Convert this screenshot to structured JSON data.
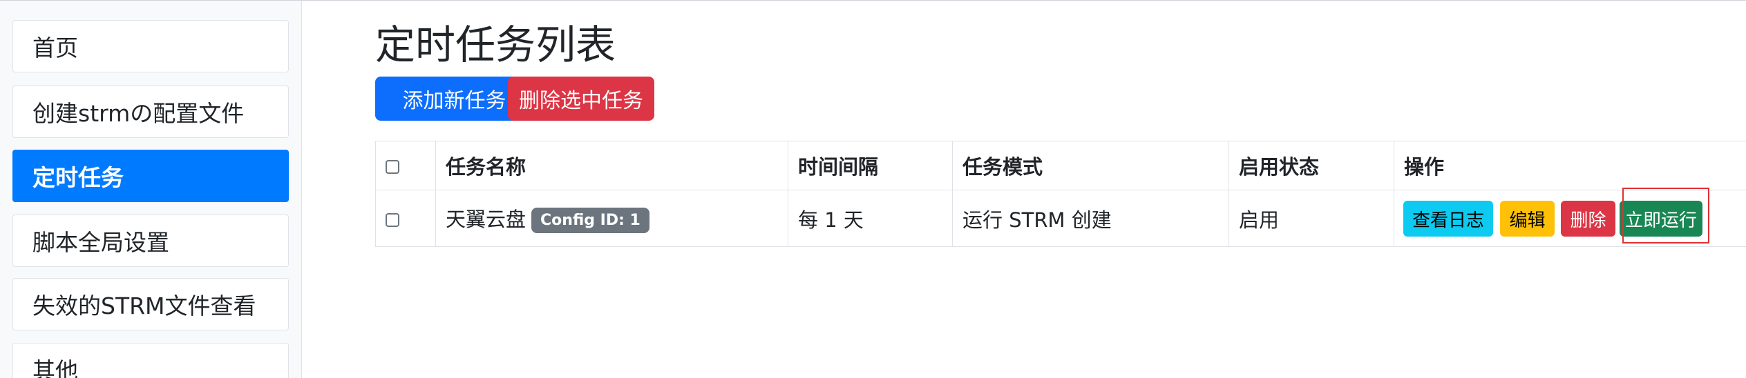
{
  "sidebar": {
    "items": [
      {
        "label": "首页",
        "active": false
      },
      {
        "label": "创建strmの配置文件",
        "active": false
      },
      {
        "label": "定时任务",
        "active": true
      },
      {
        "label": "脚本全局设置",
        "active": false
      },
      {
        "label": "失效的STRM文件查看",
        "active": false
      },
      {
        "label": "其他",
        "active": false
      }
    ]
  },
  "main": {
    "title": "定时任务列表",
    "add_button": "添加新任务",
    "delete_selected_button": "删除选中任务"
  },
  "table": {
    "headers": [
      "任务名称",
      "时间间隔",
      "任务模式",
      "启用状态",
      "操作"
    ],
    "rows": [
      {
        "name": "天翼云盘",
        "badge": "Config ID: 1",
        "interval": "每 1 天",
        "mode": "运行 STRM 创建",
        "status": "启用",
        "actions": {
          "view_log": "查看日志",
          "edit": "编辑",
          "delete": "删除",
          "run_now": "立即运行"
        }
      }
    ]
  },
  "colors": {
    "sidebar_active": "#007bff",
    "primary": "#0d6efd",
    "danger": "#dc3545",
    "info": "#0dcaf0",
    "warning": "#ffc107",
    "success": "#198754",
    "badge": "#6c757d",
    "highlight": "#e03131"
  }
}
